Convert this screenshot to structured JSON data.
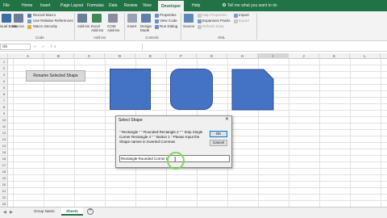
{
  "ribbon": {
    "tabs": [
      "File",
      "Home",
      "Insert",
      "Page Layout",
      "Formulas",
      "Data",
      "Review",
      "View",
      "Developer",
      "Help"
    ],
    "active_tab": "Developer",
    "tell_me": "Tell me what you want to do",
    "code_group": {
      "visual_basic": "isual Basic",
      "macros": "Macros",
      "record_macro": "Record Macro",
      "relative_refs": "Use Relative References",
      "macro_security": "Macro Security",
      "label": "Code"
    },
    "addins_group": {
      "addins": "Add-ins",
      "excel_addins": "Excel Add-ins",
      "com_addins": "COM Add-ins",
      "label": "Add-ins"
    },
    "controls_group": {
      "insert": "Insert",
      "design_mode": "Design Mode",
      "properties": "Properties",
      "view_code": "View Code",
      "run_dialog": "Run Dialog",
      "label": "Controls"
    },
    "xml_group": {
      "source": "Source",
      "map_properties": "Map Properties",
      "expansion_packs": "Expansion Packs",
      "refresh_data": "Refresh Data",
      "import": "Import",
      "export": "Export",
      "label": "XML"
    }
  },
  "formula_bar": {
    "name_box": "Ob",
    "fx": "× ✓ fx"
  },
  "columns": [
    "A",
    "B",
    "C",
    "D",
    "E",
    "F",
    "G",
    "H",
    "I",
    "J",
    "K",
    "L",
    "M"
  ],
  "rows": [
    "1",
    "2",
    "3",
    "4",
    "5",
    "6",
    "7",
    "8",
    "9",
    "10",
    "11",
    "12",
    "13",
    "14",
    "15",
    "16",
    "17",
    "18",
    "19",
    "20",
    "21",
    "22",
    "23"
  ],
  "sheet": {
    "rename_button": "Rename Selected Shape"
  },
  "dialog": {
    "title": "Select Shape",
    "message": "\" Rectangle \" \" Rounded Rectangle 2 \" \" Snip Single Corner Rectangle 4 \" \" Button 1 \" Please Input the Shape names in Inverted Commas",
    "ok": "OK",
    "cancel": "Cancel",
    "input_value": "Rectangle  Rounded Corner B"
  },
  "sheets": [
    "Group Name",
    "Sheet1"
  ],
  "active_sheet": "Sheet1",
  "colors": {
    "accent": "#217346",
    "shape_fill": "#4472c4",
    "shape_border": "#2f528f",
    "cursor_ring": "#7ed957"
  },
  "icons": [
    "search-icon",
    "record-macro-icon",
    "visual-basic-icon",
    "macros-icon",
    "addins-icon",
    "properties-icon",
    "close-icon",
    "ibeam-cursor-icon",
    "add-sheet-icon"
  ]
}
